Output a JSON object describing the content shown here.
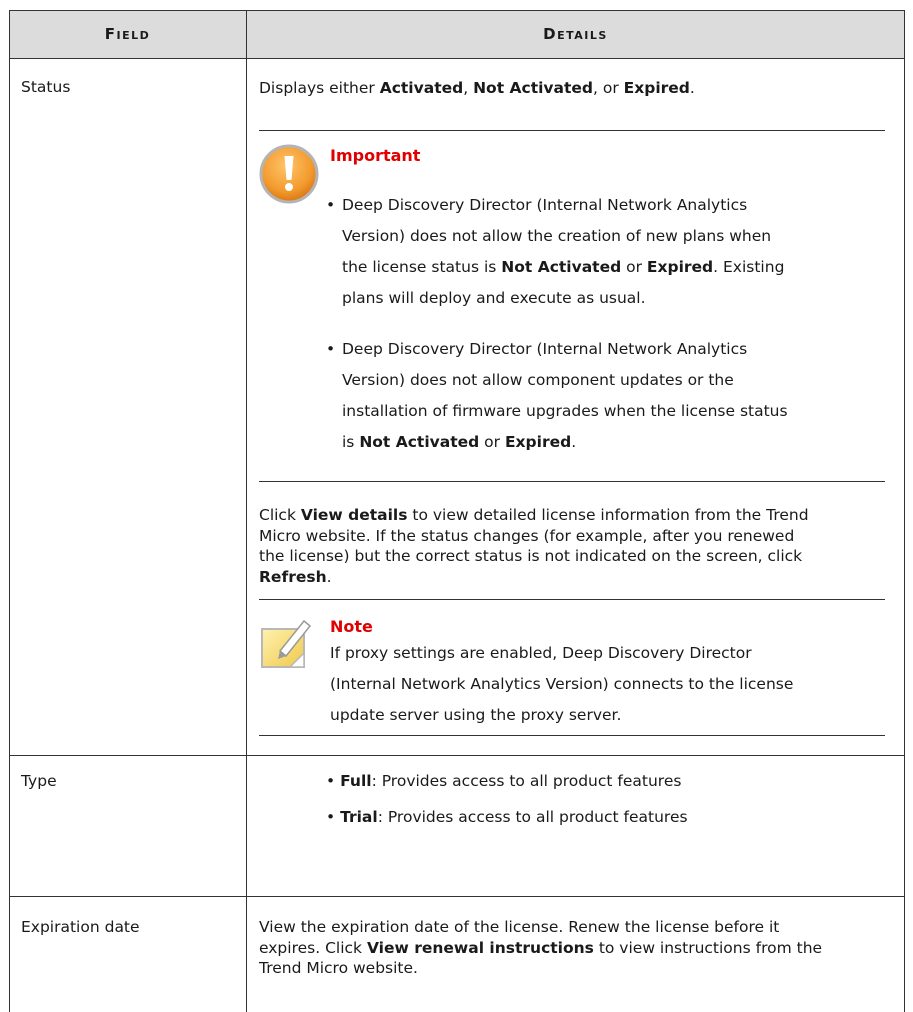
{
  "table": {
    "headers": {
      "field": "Field",
      "details": "Details"
    },
    "status": {
      "field": "Status",
      "intro_prefix": "Displays either ",
      "intro_b1": "Activated",
      "intro_sep1": ", ",
      "intro_b2": "Not Activated",
      "intro_sep2": ", or ",
      "intro_b3": "Expired",
      "intro_end": ".",
      "important": {
        "title": "Important",
        "bullet1": {
          "line1": "Deep Discovery Director (Internal Network Analytics",
          "line2": "Version) does not allow the creation of new plans when",
          "line3_prefix": "the license status is ",
          "line3_b1": "Not Activated",
          "line3_mid": " or ",
          "line3_b2": "Expired",
          "line3_end": ". Existing",
          "line4": "plans will deploy and execute as usual."
        },
        "bullet2": {
          "line1": "Deep Discovery Director (Internal Network Analytics",
          "line2": "Version) does not allow component updates or the",
          "line3": "installation of firmware upgrades when the license status",
          "line4_prefix": "is ",
          "line4_b1": "Not Activated",
          "line4_mid": " or ",
          "line4_b2": "Expired",
          "line4_end": "."
        }
      },
      "click_para": {
        "l1_prefix": "Click ",
        "l1_b": "View details",
        "l1_rest": " to view detailed license information from the Trend",
        "l2": "Micro website. If the status changes (for example, after you renewed",
        "l3": "the license) but the correct status is not indicated on the screen, click",
        "l4_b": "Refresh",
        "l4_end": "."
      },
      "note": {
        "title": "Note",
        "line1": "If proxy settings are enabled, Deep Discovery Director",
        "line2": "(Internal Network Analytics Version) connects to the license",
        "line3": "update server using the proxy server."
      }
    },
    "type": {
      "field": "Type",
      "b1_label": "Full",
      "b1_text": ": Provides access to all product features",
      "b2_label": "Trial",
      "b2_text": ": Provides access to all product features"
    },
    "expiration": {
      "field": "Expiration date",
      "l1": "View the expiration date of the license. Renew the license before it",
      "l2_prefix": "expires. Click ",
      "l2_b": "View renewal instructions",
      "l2_rest": " to view instructions from the",
      "l3": "Trend Micro website."
    }
  },
  "icons": {
    "important": "exclamation-warning-icon",
    "note": "note-pencil-icon"
  },
  "colors": {
    "callout_title": "#e10000",
    "header_bg": "#dcdcdc",
    "warning_orange": "#f39a2e",
    "note_yellow": "#f5d66a"
  }
}
